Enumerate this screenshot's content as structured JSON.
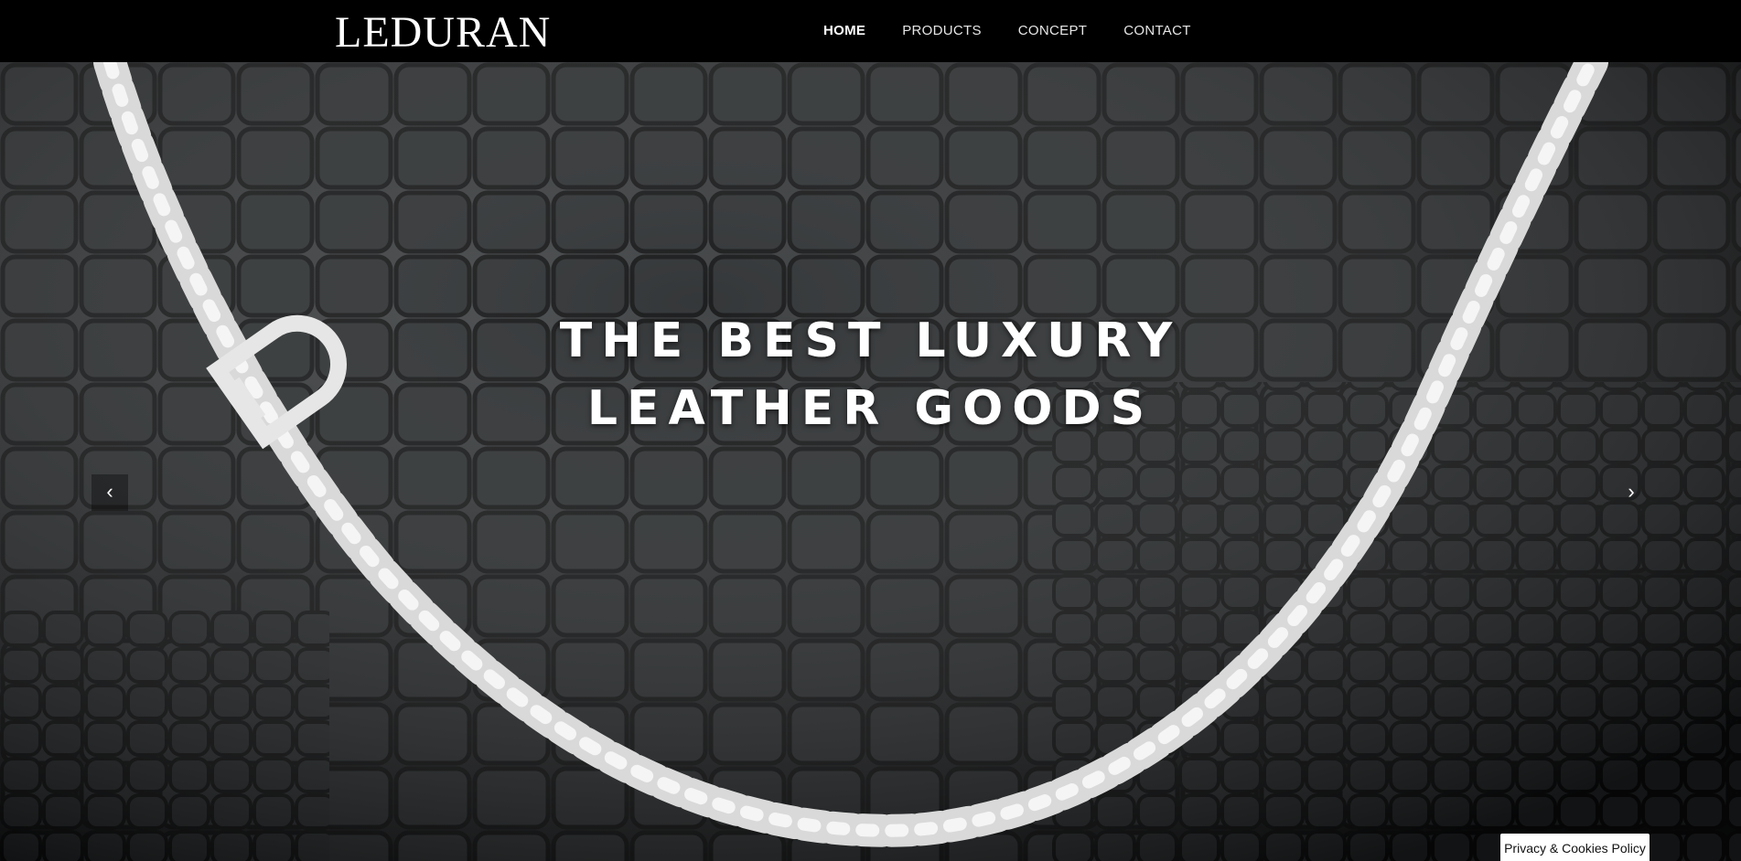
{
  "brand": {
    "logo_text": "LEDURAN"
  },
  "nav": {
    "items": [
      {
        "label": "HOME",
        "active": true
      },
      {
        "label": "PRODUCTS",
        "active": false
      },
      {
        "label": "CONCEPT",
        "active": false
      },
      {
        "label": "CONTACT",
        "active": false
      }
    ]
  },
  "hero": {
    "title_line1": "THE BEST LUXURY",
    "title_line2": "LEATHER GOODS",
    "prev_icon": "chevron-left-icon",
    "next_icon": "chevron-right-icon",
    "prev_glyph": "‹",
    "next_glyph": "›"
  },
  "footer": {
    "cookie_label": "Privacy & Cookies Policy"
  },
  "colors": {
    "nav_bg": "#000000",
    "text": "#ffffff",
    "leather": "#1d1f21",
    "chain": "#e8e8e8"
  }
}
